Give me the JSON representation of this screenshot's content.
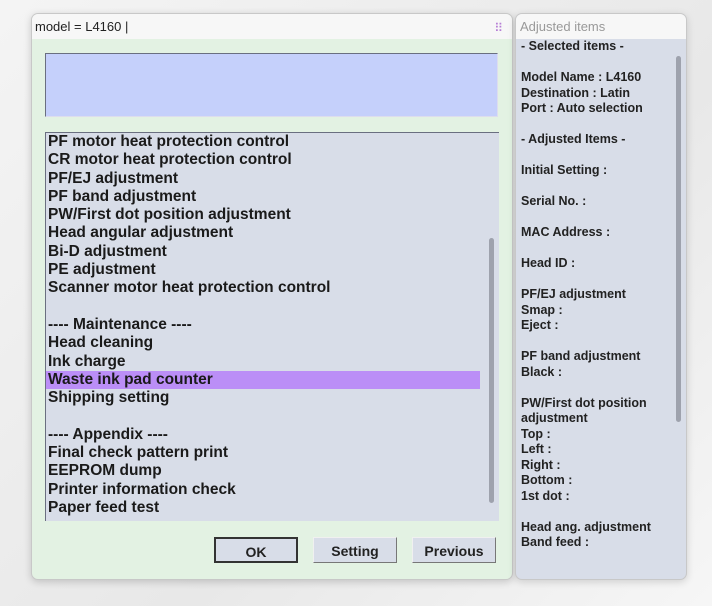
{
  "window": {
    "title": "model = L4160 |",
    "grip_icon": "grid-dots-icon"
  },
  "list": {
    "items": [
      "PF motor heat protection control",
      "CR motor heat protection control",
      "PF/EJ adjustment",
      "PF band adjustment",
      "PW/First dot position adjustment",
      "Head angular adjustment",
      "Bi-D adjustment",
      "PE adjustment",
      "Scanner motor heat protection control",
      "",
      "---- Maintenance ----",
      "Head cleaning",
      "Ink charge",
      "Waste ink pad counter",
      "Shipping setting",
      "",
      "---- Appendix ----",
      "Final check pattern print",
      "EEPROM dump",
      "Printer information check",
      "Paper feed test"
    ],
    "selected": "Waste ink pad counter",
    "highlight_color": "#bb8ef7"
  },
  "buttons": {
    "ok": "OK",
    "setting": "Setting",
    "previous": "Previous"
  },
  "panel": {
    "title": "Adjusted items",
    "lines": [
      "- Selected items -",
      "",
      "Model Name : L4160",
      "Destination : Latin",
      "Port : Auto selection",
      "",
      "- Adjusted Items -",
      "",
      "Initial Setting :",
      "",
      " Serial No. :",
      "",
      "MAC Address :",
      "",
      "Head ID :",
      "",
      "PF/EJ adjustment",
      " Smap :",
      " Eject :",
      "",
      "PF band adjustment",
      " Black :",
      "",
      "PW/First dot position",
      "adjustment",
      " Top :",
      " Left :",
      " Right :",
      " Bottom :",
      " 1st dot :",
      "",
      "Head ang. adjustment",
      " Band feed :"
    ]
  }
}
